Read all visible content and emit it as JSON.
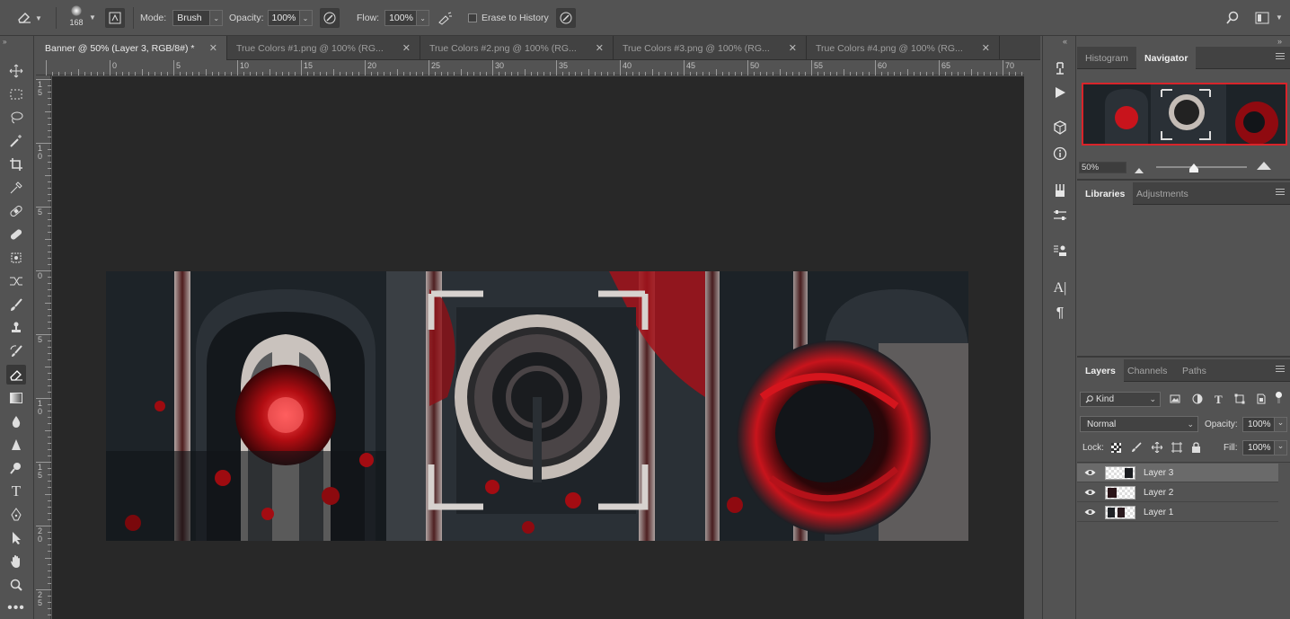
{
  "options": {
    "brush_size": "168",
    "mode_label": "Mode:",
    "mode_value": "Brush",
    "opacity_label": "Opacity:",
    "opacity_value": "100%",
    "flow_label": "Flow:",
    "flow_value": "100%",
    "erase_history_label": "Erase to History"
  },
  "tabs": [
    {
      "label": "Banner @ 50% (Layer 3, RGB/8#) *",
      "active": true
    },
    {
      "label": "True Colors #1.png @ 100% (RG..."
    },
    {
      "label": "True Colors #2.png @ 100% (RG..."
    },
    {
      "label": "True Colors #3.png @ 100% (RG..."
    },
    {
      "label": "True Colors #4.png @ 100% (RG..."
    }
  ],
  "ruler": {
    "h_labels": [
      "0",
      "5",
      "10",
      "15",
      "20",
      "25",
      "30",
      "35",
      "40",
      "45",
      "50",
      "55",
      "60",
      "65",
      "70"
    ],
    "v_labels": [
      "1\n5",
      "1\n0",
      "5",
      "0",
      "5",
      "1\n0",
      "1\n5",
      "2\n0",
      "2\n5"
    ]
  },
  "navigator": {
    "tabs": [
      "Histogram",
      "Navigator"
    ],
    "zoom": "50%"
  },
  "libraries": {
    "tabs": [
      "Libraries",
      "Adjustments"
    ]
  },
  "layers_panel": {
    "tabs": [
      "Layers",
      "Channels",
      "Paths"
    ],
    "filter_label": "Kind",
    "blend_mode": "Normal",
    "opacity_label": "Opacity:",
    "opacity_value": "100%",
    "lock_label": "Lock:",
    "fill_label": "Fill:",
    "fill_value": "100%",
    "layers": [
      {
        "name": "Layer 3",
        "selected": true
      },
      {
        "name": "Layer 2"
      },
      {
        "name": "Layer 1"
      }
    ]
  },
  "colors": {
    "accent_red": "#c8141c",
    "canvas_bg": "#282828",
    "panel_bg": "#535353"
  }
}
